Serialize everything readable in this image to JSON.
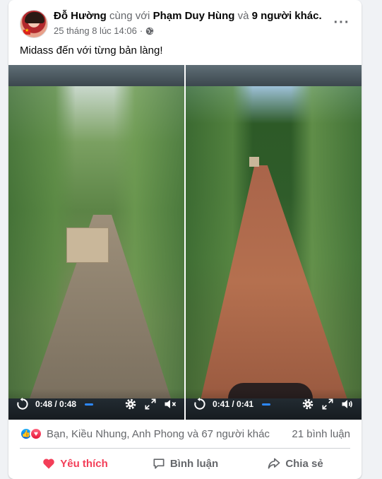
{
  "post": {
    "author": "Đỗ Hường",
    "with_text": "cùng với",
    "tagged": "Phạm Duy Hùng",
    "and_text": "và",
    "others": "9 người khác.",
    "timestamp": "25 tháng 8 lúc 14:06",
    "privacy_icon": "globe-icon",
    "caption": "Midass đến với từng bản làng!"
  },
  "videos": [
    {
      "time": "0:48 / 0:48",
      "volume_icon": "volume-muted-icon"
    },
    {
      "time": "0:41 / 0:41",
      "volume_icon": "volume-icon"
    }
  ],
  "reactions": {
    "types": [
      "like",
      "love"
    ],
    "summary": "Bạn, Kiều Nhung, Anh Phong và 67 người khác",
    "comments": "21 bình luận"
  },
  "actions": {
    "like": "Yêu thích",
    "comment": "Bình luận",
    "share": "Chia sẻ"
  },
  "colors": {
    "accent": "#2d88ff",
    "love": "#f33e58",
    "muted": "#65676b"
  }
}
